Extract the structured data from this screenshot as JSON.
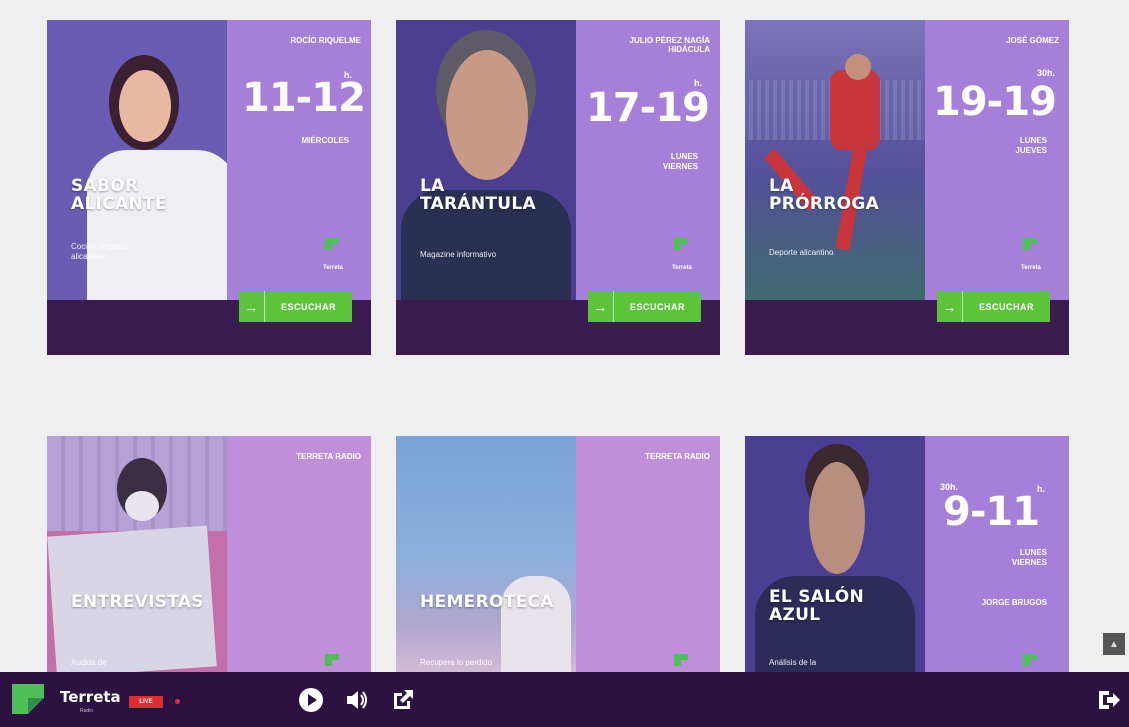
{
  "colors": {
    "background": "#efefef",
    "card_left": "#5c4aa6",
    "card_right": "#a67fd8",
    "card_bottom": "#3b1c50",
    "listen_green": "#5cc43a",
    "player_bg": "#2d1241",
    "live_red": "#e02d2d",
    "brand_green": "#4fbf5a"
  },
  "cards": [
    {
      "title_lines": [
        "SABOR",
        "ALICANTE"
      ],
      "subtitle": "Cocina empresa alicantina",
      "presenter": "ROCÍO RIQUELME",
      "time": "11-12",
      "time_sup": "h.",
      "days": "MIÉRCOLES",
      "brand": "Terreta",
      "listen": "ESCUCHAR"
    },
    {
      "title_lines": [
        "LA",
        "TARÁNTULA"
      ],
      "subtitle": "Magazine informativo",
      "presenter": "JULIO PÉREZ NAGÍA HIDÁCULA",
      "time": "17-19",
      "time_sup": "h.",
      "days": "LUNES VIERNES",
      "brand": "Terreta",
      "listen": "ESCUCHAR"
    },
    {
      "title_lines": [
        "LA",
        "PRÓRROGA"
      ],
      "subtitle": "Deporte alicantino",
      "presenter": "JOSÉ GÓMEZ",
      "time": "19-19",
      "time_sup": "30h.",
      "days": "LUNES JUEVES",
      "brand": "Terreta",
      "listen": "ESCUCHAR"
    },
    {
      "title_lines": [
        "ENTREVISTAS"
      ],
      "subtitle": "Audios de",
      "presenter": "TERRETA RADIO"
    },
    {
      "title_lines": [
        "HEMEROTECA"
      ],
      "subtitle": "Recupera lo perdido",
      "presenter": "TERRETA RADIO"
    },
    {
      "title_lines": [
        "EL SALÓN",
        "AZUL"
      ],
      "subtitle": "Análisis de la",
      "presenter": "JORGE BRUGOS",
      "time": "9-11",
      "time_sup_left": "30h.",
      "time_sup": "h.",
      "days": "LUNES VIERNES"
    }
  ],
  "player": {
    "station": "Terreta",
    "station_sub": "Radio",
    "live": "LIVE",
    "icons": [
      "play-icon",
      "volume-icon",
      "external-link-icon",
      "exit-icon"
    ]
  },
  "scroll_top_icon": "▲"
}
